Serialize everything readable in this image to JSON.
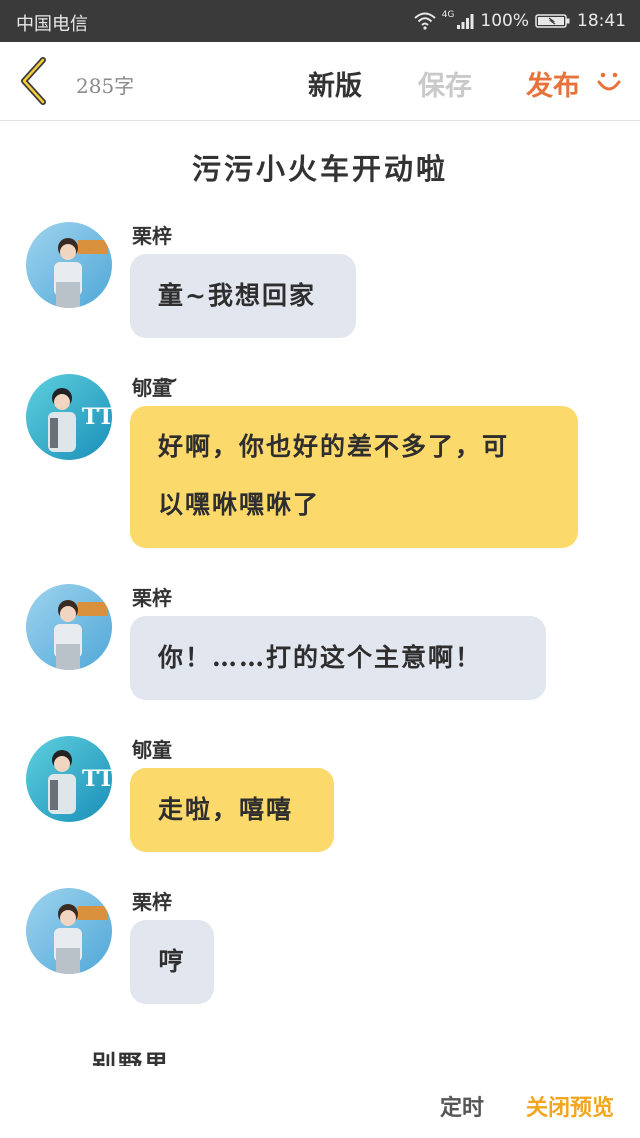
{
  "status_bar": {
    "carrier": "中国电信",
    "network": "4G",
    "battery": "100%",
    "time": "18:41"
  },
  "toolbar": {
    "word_count": "285字",
    "new_version_label": "新版",
    "save_label": "保存",
    "publish_label": "发布"
  },
  "story": {
    "title": "污污小火车开动啦"
  },
  "messages": [
    {
      "sender": "栗梓",
      "text": "童~我想回家~",
      "color": "grey"
    },
    {
      "sender": "郇童",
      "lines": [
        "好啊，你也好的差不多了，可",
        "以嘿咻嘿咻了"
      ],
      "color": "yellow"
    },
    {
      "sender": "栗梓",
      "text": "你！……打的这个主意啊！",
      "color": "grey"
    },
    {
      "sender": "郇童",
      "text": "走啦，嘻嘻",
      "color": "yellow"
    },
    {
      "sender": "栗梓",
      "text": "哼",
      "color": "grey"
    }
  ],
  "truncated_next": "别野里",
  "bottom": {
    "timer_label": "定时",
    "close_preview_label": "关闭预览"
  },
  "colors": {
    "accent_publish": "#e8733a",
    "accent_close_preview": "#f2a51f",
    "bubble_grey": "#e2e6ef",
    "bubble_yellow": "#fcd96b"
  }
}
